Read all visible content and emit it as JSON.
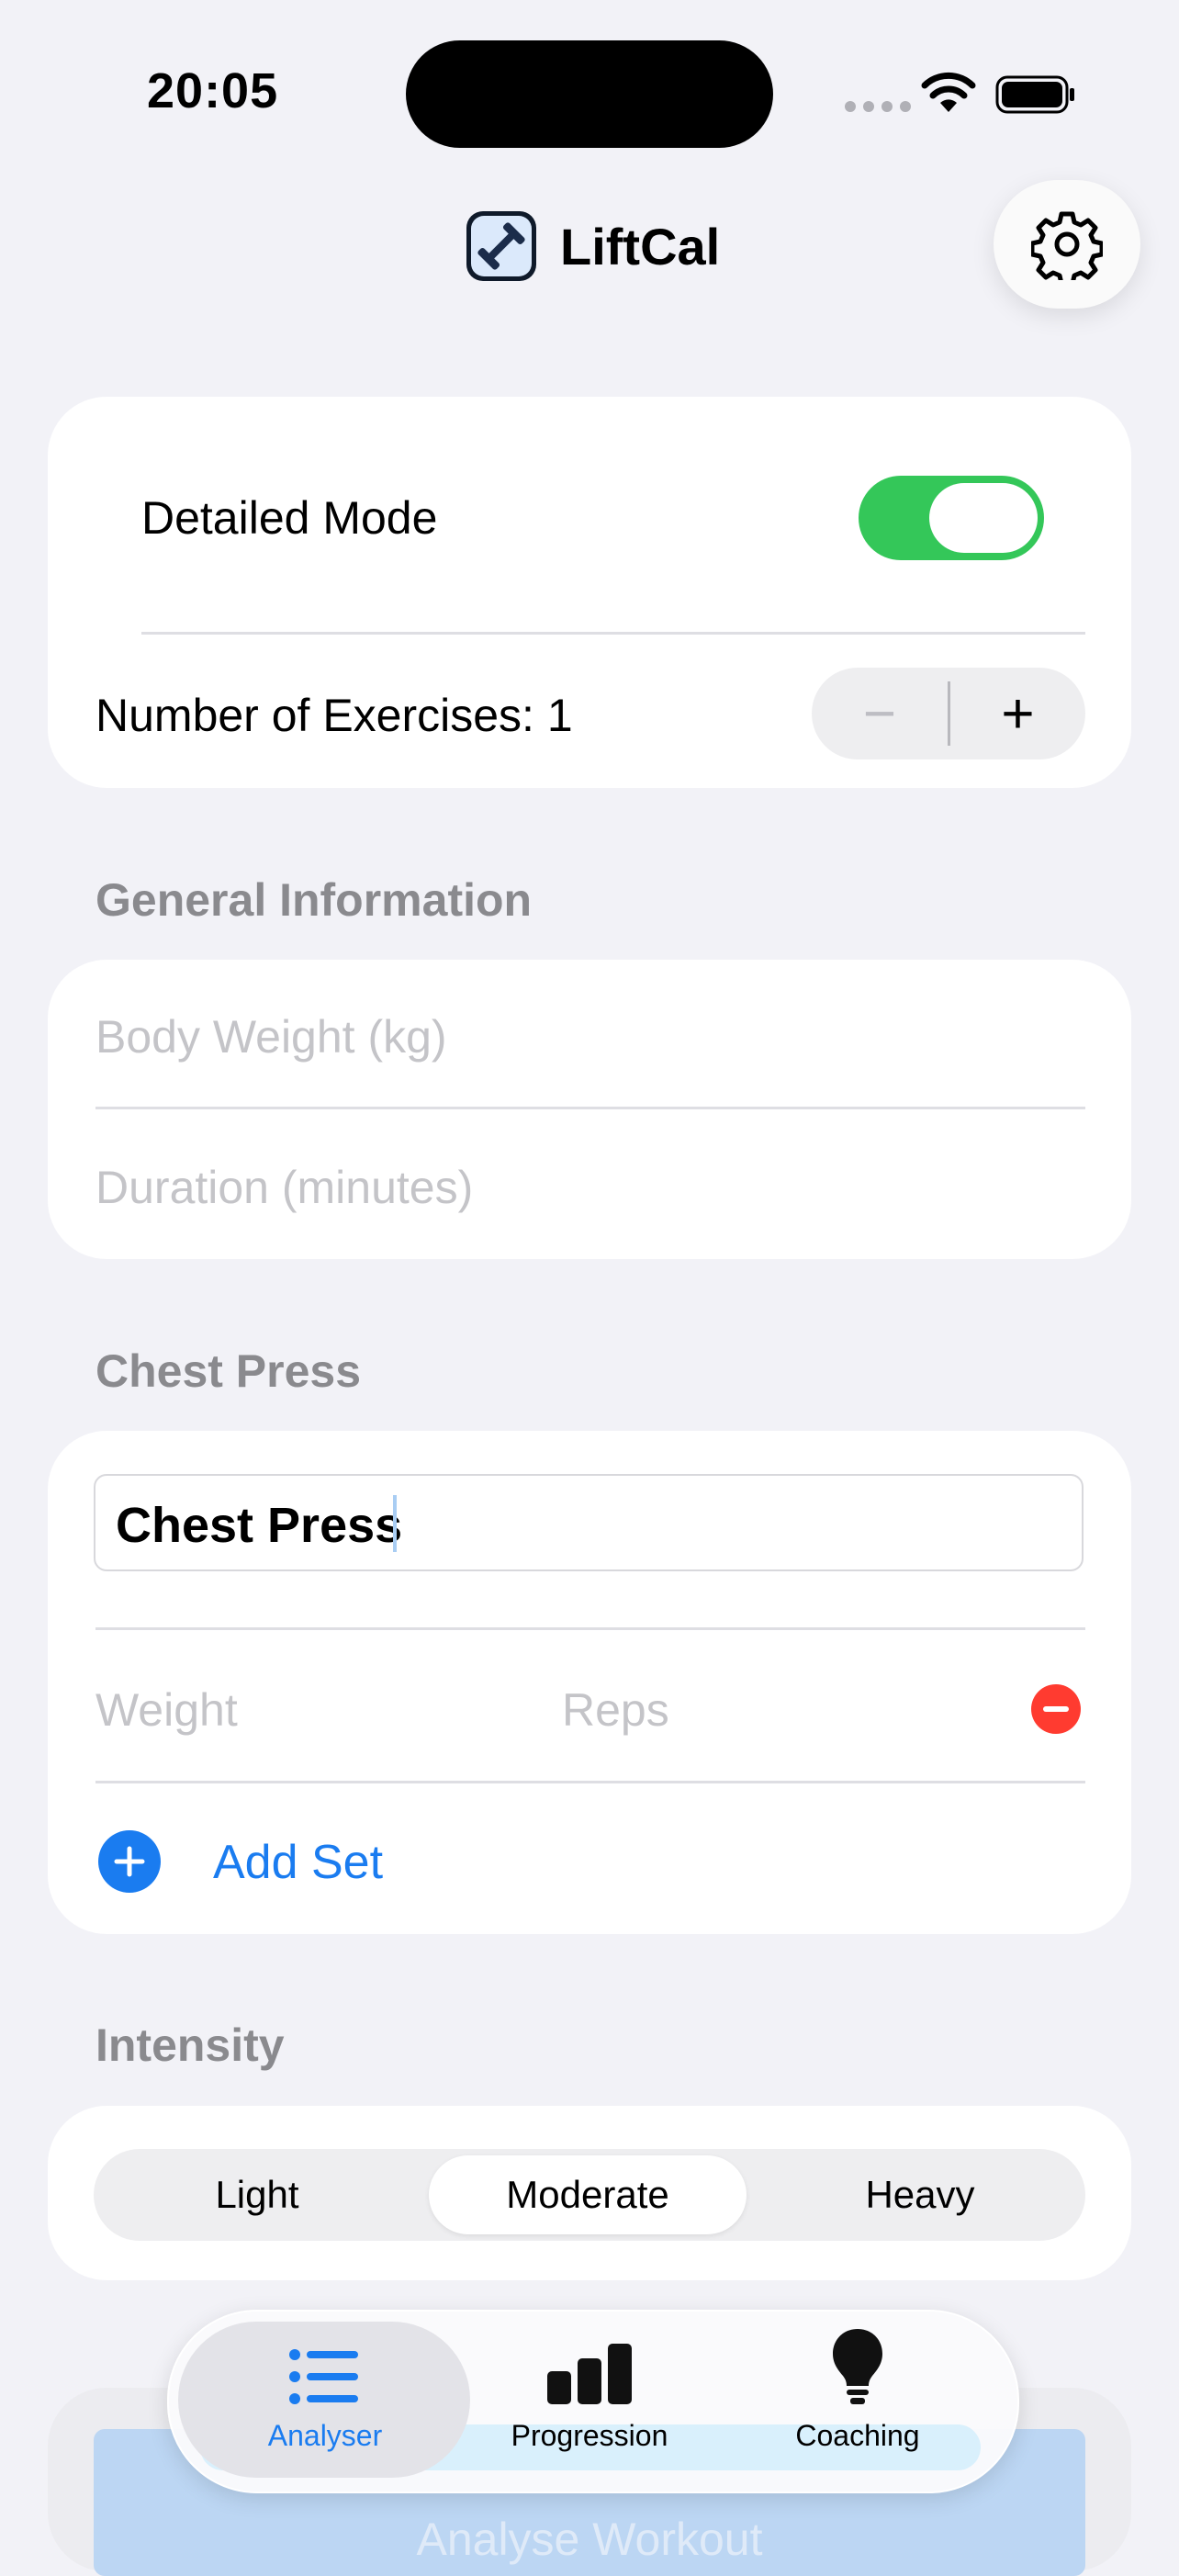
{
  "status_bar": {
    "time": "20:05"
  },
  "header": {
    "app_name": "LiftCal"
  },
  "detailed_mode": {
    "label": "Detailed Mode",
    "enabled": true,
    "exercises_label": "Number of Exercises: 1",
    "minus": "−",
    "plus": "+"
  },
  "general_information": {
    "section_title": "General Information",
    "body_weight_placeholder": "Body Weight (kg)",
    "duration_placeholder": "Duration (minutes)"
  },
  "exercise": {
    "section_title": "Chest Press",
    "name_value": "Chest Press",
    "weight_placeholder": "Weight",
    "reps_placeholder": "Reps",
    "add_set_label": "Add Set"
  },
  "intensity": {
    "section_title": "Intensity",
    "options": [
      "Light",
      "Moderate",
      "Heavy"
    ],
    "selected": "Moderate"
  },
  "analyse_button": {
    "label": "Analyse Workout"
  },
  "tab_bar": {
    "tabs": [
      {
        "label": "Analyser",
        "icon": "list-icon",
        "selected": true
      },
      {
        "label": "Progression",
        "icon": "bar-chart-icon",
        "selected": false
      },
      {
        "label": "Coaching",
        "icon": "lightbulb-icon",
        "selected": false
      }
    ]
  },
  "colors": {
    "accent": "#1a7cf0",
    "toggle_on": "#34c759",
    "destructive": "#ff3b30",
    "background": "#f2f2f7"
  }
}
